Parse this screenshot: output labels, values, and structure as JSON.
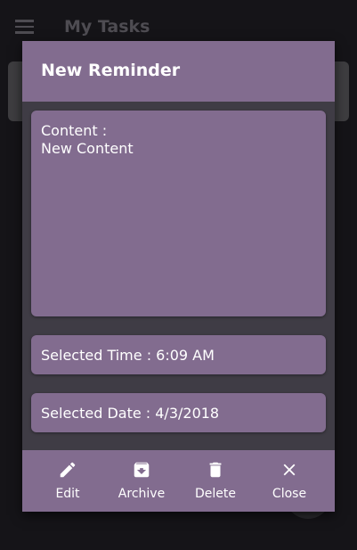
{
  "appbar": {
    "title": "My Tasks",
    "menu_icon": "menu-icon"
  },
  "dialog": {
    "title": "New Reminder",
    "content_label": "Content :",
    "content_value": "New Content",
    "selected_time": "Selected Time : 6:09 AM",
    "selected_date": "Selected Date : 4/3/2018"
  },
  "actions": [
    {
      "label": "Edit",
      "icon": "pencil-icon"
    },
    {
      "label": "Archive",
      "icon": "archive-icon"
    },
    {
      "label": "Delete",
      "icon": "trash-icon"
    },
    {
      "label": "Close",
      "icon": "close-icon"
    }
  ],
  "colors": {
    "accent": "#826c8f",
    "dialog_bg": "#3f3c45",
    "screen_bg": "#151418"
  }
}
